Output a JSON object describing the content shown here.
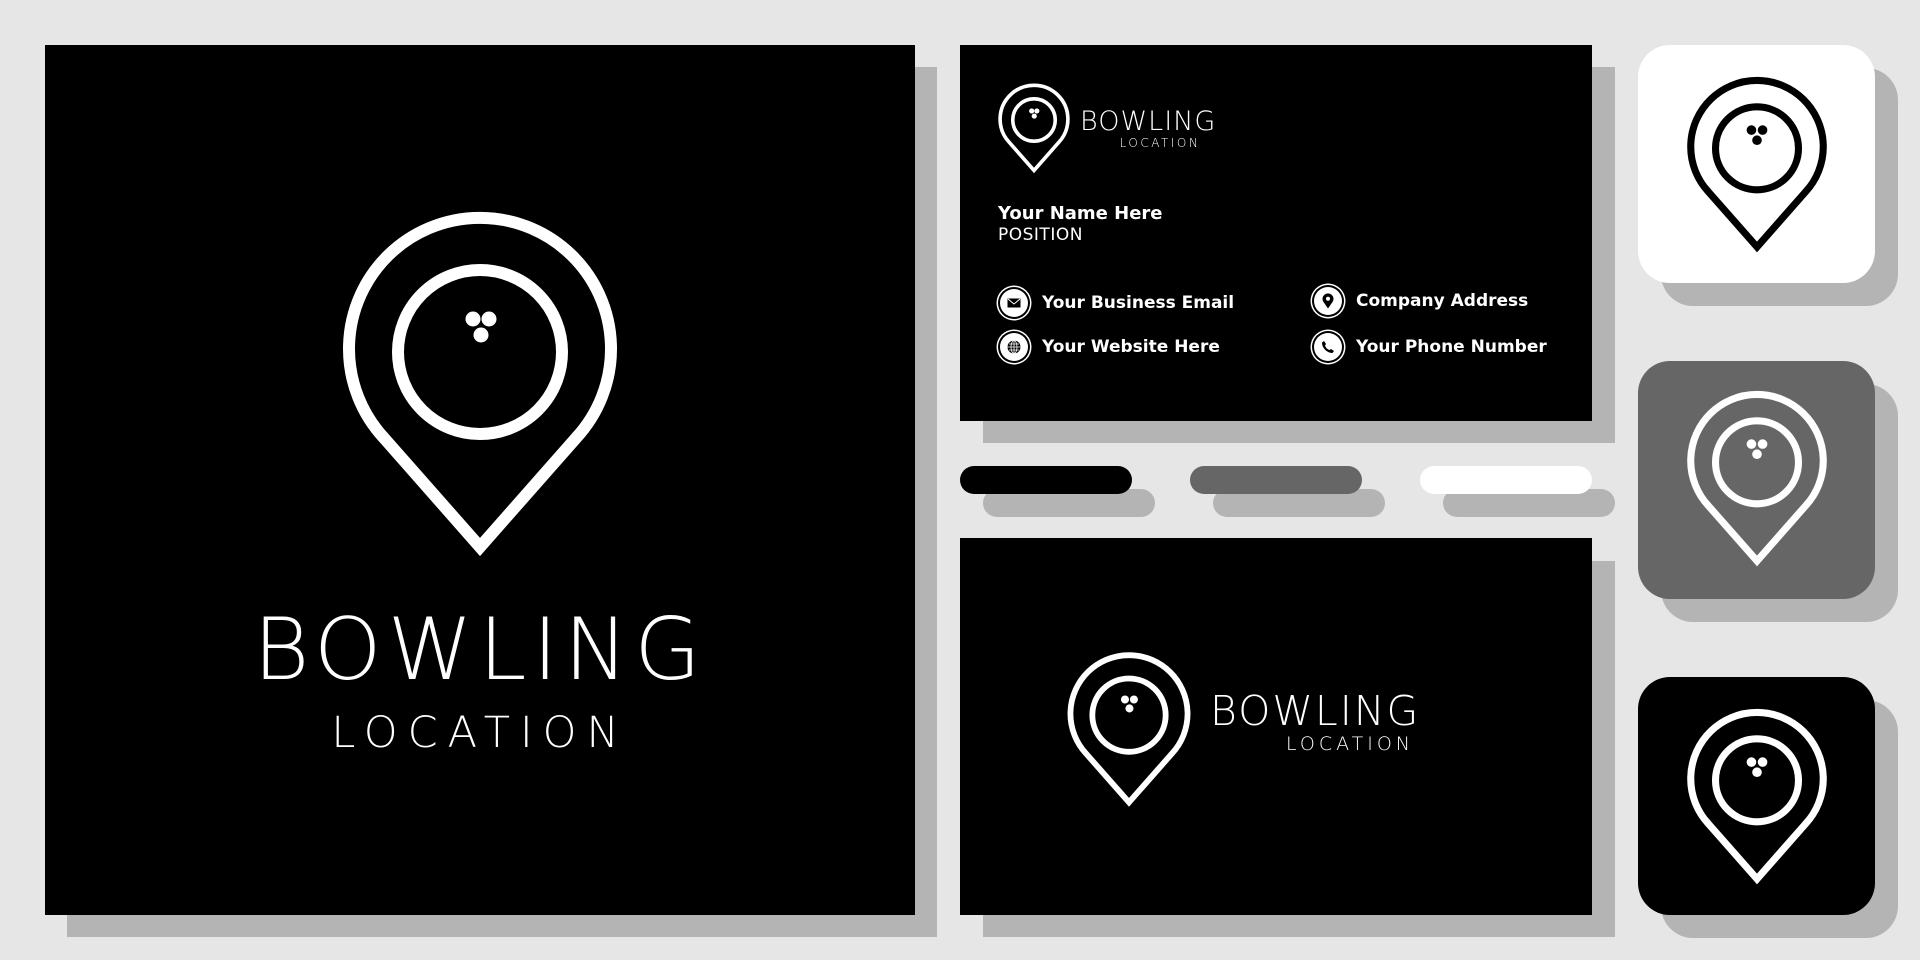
{
  "brand": {
    "name": "BOWLING",
    "tagline": "LOCATION"
  },
  "business_card": {
    "person_name": "Your Name Here",
    "position": "POSITION",
    "contacts": [
      {
        "icon": "envelope-icon",
        "label": "Your Business Email"
      },
      {
        "icon": "globe-icon",
        "label": "Your Website Here"
      },
      {
        "icon": "map-pin-icon",
        "label": "Company Address"
      },
      {
        "icon": "phone-icon",
        "label": "Your Phone Number"
      }
    ]
  },
  "palette": {
    "swatches": [
      "#000000",
      "#666666",
      "#ffffff"
    ],
    "background": "#e6e6e6",
    "shadow": "#b4b4b4"
  },
  "app_icons": [
    {
      "variant": "white",
      "bg": "#ffffff",
      "fg": "#000000"
    },
    {
      "variant": "gray",
      "bg": "#666666",
      "fg": "#ffffff"
    },
    {
      "variant": "black",
      "bg": "#000000",
      "fg": "#ffffff"
    }
  ]
}
